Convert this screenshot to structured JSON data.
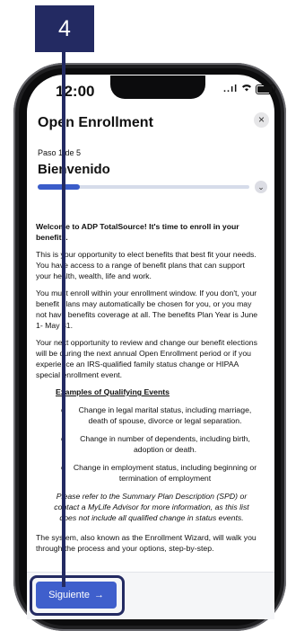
{
  "callout": {
    "number": "4"
  },
  "status_bar": {
    "time": "12:00",
    "signal": "..ıl"
  },
  "header": {
    "title": "Open Enrollment",
    "close_icon": "×"
  },
  "step": {
    "label": "Paso 1 de 5",
    "title": "Bienvenido",
    "progress": 0.2,
    "expand_icon": "⌄"
  },
  "content": {
    "intro_bold": "Welcome to ADP TotalSource! It's time to enroll in your benefits.",
    "para1": "This is your opportunity to elect benefits that best fit your needs. You have access to a range of benefit plans that can support your health, wealth, life and work.",
    "para2": "You must enroll within your enrollment window. If you don't, your benefit plans may automatically be chosen for you, or you may not have benefits coverage at all. The benefits Plan Year is June 1- May 31.",
    "para3": "Your next opportunity to review and change our benefit elections will be during the next annual Open Enrollment period or if you experience an IRS-qualified family status change or HIPAA special enrollment event.",
    "events_heading": "Examples of Qualifying Events",
    "events": [
      "Change in legal marital status, including marriage, death of spouse, divorce or legal separation.",
      "Change in number of dependents, including birth, adoption or death.",
      "Change in employment status, including beginning or termination of employment"
    ],
    "note": "Please refer to the Summary Plan Description (SPD) or contact a MyLife Advisor for more information, as this list does not include all qualified change in status events.",
    "para4": "The system, also known as the Enrollment Wizard, will walk you through the process and your options, step-by-step."
  },
  "footer": {
    "next_label": "Siguiente",
    "next_arrow": "→"
  },
  "colors": {
    "callout": "#232a62",
    "accent": "#3f5fcc"
  }
}
